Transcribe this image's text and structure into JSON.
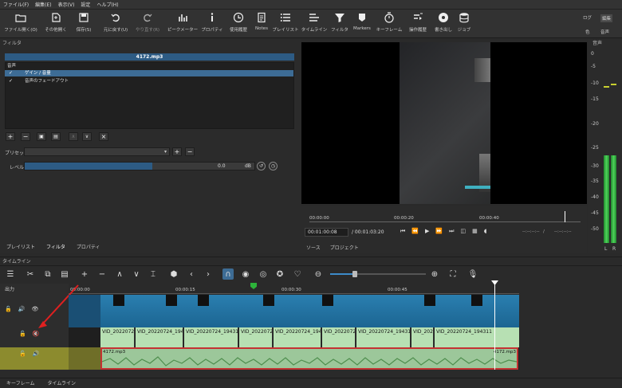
{
  "menu": [
    "ファイル(F)",
    "編集(E)",
    "表示(V)",
    "設定",
    "ヘルプ(H)"
  ],
  "toolbar": {
    "buttons": [
      {
        "label": "ファイル開く(O)",
        "icon": "folder-icon"
      },
      {
        "label": "その他開く",
        "icon": "open-other-icon"
      },
      {
        "label": "保存(S)",
        "icon": "save-icon"
      },
      {
        "label": "元に戻す(U)",
        "icon": "undo-icon"
      },
      {
        "label": "やり直す(R)",
        "icon": "redo-icon"
      },
      {
        "label": "ピークメーター",
        "icon": "peak-meter-icon"
      },
      {
        "label": "プロパティ",
        "icon": "info-icon"
      },
      {
        "label": "使用履歴",
        "icon": "history-icon"
      },
      {
        "label": "Notes",
        "icon": "notes-icon"
      },
      {
        "label": "プレイリスト",
        "icon": "playlist-icon"
      },
      {
        "label": "タイムライン",
        "icon": "timeline-icon"
      },
      {
        "label": "フィルタ",
        "icon": "filter-icon"
      },
      {
        "label": "Markers",
        "icon": "markers-icon"
      },
      {
        "label": "キーフレーム",
        "icon": "keyframe-icon"
      },
      {
        "label": "操作履歴",
        "icon": "jobs-history-icon"
      },
      {
        "label": "書き出し",
        "icon": "export-icon"
      },
      {
        "label": "ジョブ",
        "icon": "jobs-icon"
      }
    ],
    "right_top": [
      "ログ",
      "編集"
    ],
    "right_bottom": [
      "色",
      "音声"
    ]
  },
  "filters_panel": {
    "title": "フィルタ",
    "clip_title": "4172.mp3",
    "section": "音声",
    "items": [
      {
        "label": "ゲイン / 音量",
        "checked": true,
        "selected": true
      },
      {
        "label": "音声のフェードアウト",
        "checked": true,
        "selected": false
      }
    ],
    "preset_label": "プリセット",
    "level_label": "レベル",
    "level_value": "0.0",
    "level_unit": "dB",
    "tabs": [
      "プレイリスト",
      "フィルタ",
      "プロパティ"
    ]
  },
  "meter": {
    "title": "音声",
    "ticks": [
      "0",
      "-5",
      "-10",
      "-15",
      "-20",
      "-25",
      "-30",
      "-35",
      "-40",
      "-45",
      "-50"
    ],
    "left_label": "L",
    "right_label": "R"
  },
  "player": {
    "ruler": [
      "00:00:00",
      "00:00:20",
      "00:00:40"
    ],
    "position": "00:01:00:08",
    "duration": "/ 00:01:03:20",
    "in_point": "--:--:--:--",
    "out_point": "--:--:--:--",
    "in_out_separator": "/",
    "tabs": [
      "ソース",
      "プロジェクト"
    ]
  },
  "timeline": {
    "title": "タイムライン",
    "output_label": "出力",
    "ruler": [
      "00:00:00",
      "00:00:15",
      "00:00:30",
      "00:00:45"
    ],
    "video_clips": [
      "VID_2022072",
      "VID_20220724_194",
      "VID_20220724_19431",
      "VID_20220724",
      "VID_20220724_194",
      "VID_2022072",
      "VID_20220724_19431",
      "VID_202",
      "VID_20220724_194311"
    ],
    "audio_clip_start": "4172.mp3",
    "audio_clip_end": "4172.mp3"
  },
  "statusbar": {
    "tabs": [
      "キーフレーム",
      "タイムライン"
    ]
  },
  "colors": {
    "accent": "#2d5b84",
    "video_clip": "#1f6f9b",
    "audio_clip": "#a9d3a6",
    "audio_selected_border": "#d64040",
    "annotation_arrow": "#e02020"
  }
}
